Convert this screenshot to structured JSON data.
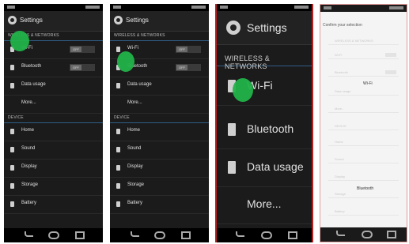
{
  "panels": [
    {
      "title": "Settings",
      "section_wireless": "WIRELESS & NETWORKS",
      "section_device": "DEVICE",
      "items": [
        "Wi-Fi",
        "Bluetooth",
        "Data usage",
        "More...",
        "Home",
        "Sound",
        "Display",
        "Storage",
        "Battery"
      ],
      "toggle_off": "OFF"
    },
    {
      "title": "Settings",
      "section_wireless": "WIRELESS & NETWORKS",
      "section_device": "DEVICE",
      "items": [
        "Wi-Fi",
        "Bluetooth",
        "Data usage",
        "More...",
        "Home",
        "Sound",
        "Display",
        "Storage",
        "Battery"
      ],
      "toggle_off": "OFF"
    },
    {
      "title": "Settings",
      "section_wireless": "WIRELESS & NETWORKS",
      "items": [
        "Wi-Fi",
        "Bluetooth",
        "Data usage",
        "More..."
      ]
    },
    {
      "title": "Confirm your selection",
      "faint_section_wireless": "WIRELESS & NETWORKS",
      "faint_section_device": "DEVICE",
      "faint_items": [
        "Wi-Fi",
        "Bluetooth",
        "Data usage",
        "More...",
        "Home",
        "Sound",
        "Display",
        "Storage",
        "Battery"
      ],
      "option_wifi": "Wi-Fi",
      "option_bluetooth": "Bluetooth"
    }
  ],
  "colors": {
    "touch_marker": "#22b34a",
    "section_divider": "#2f5d86",
    "frame_highlight": "#b52020"
  }
}
